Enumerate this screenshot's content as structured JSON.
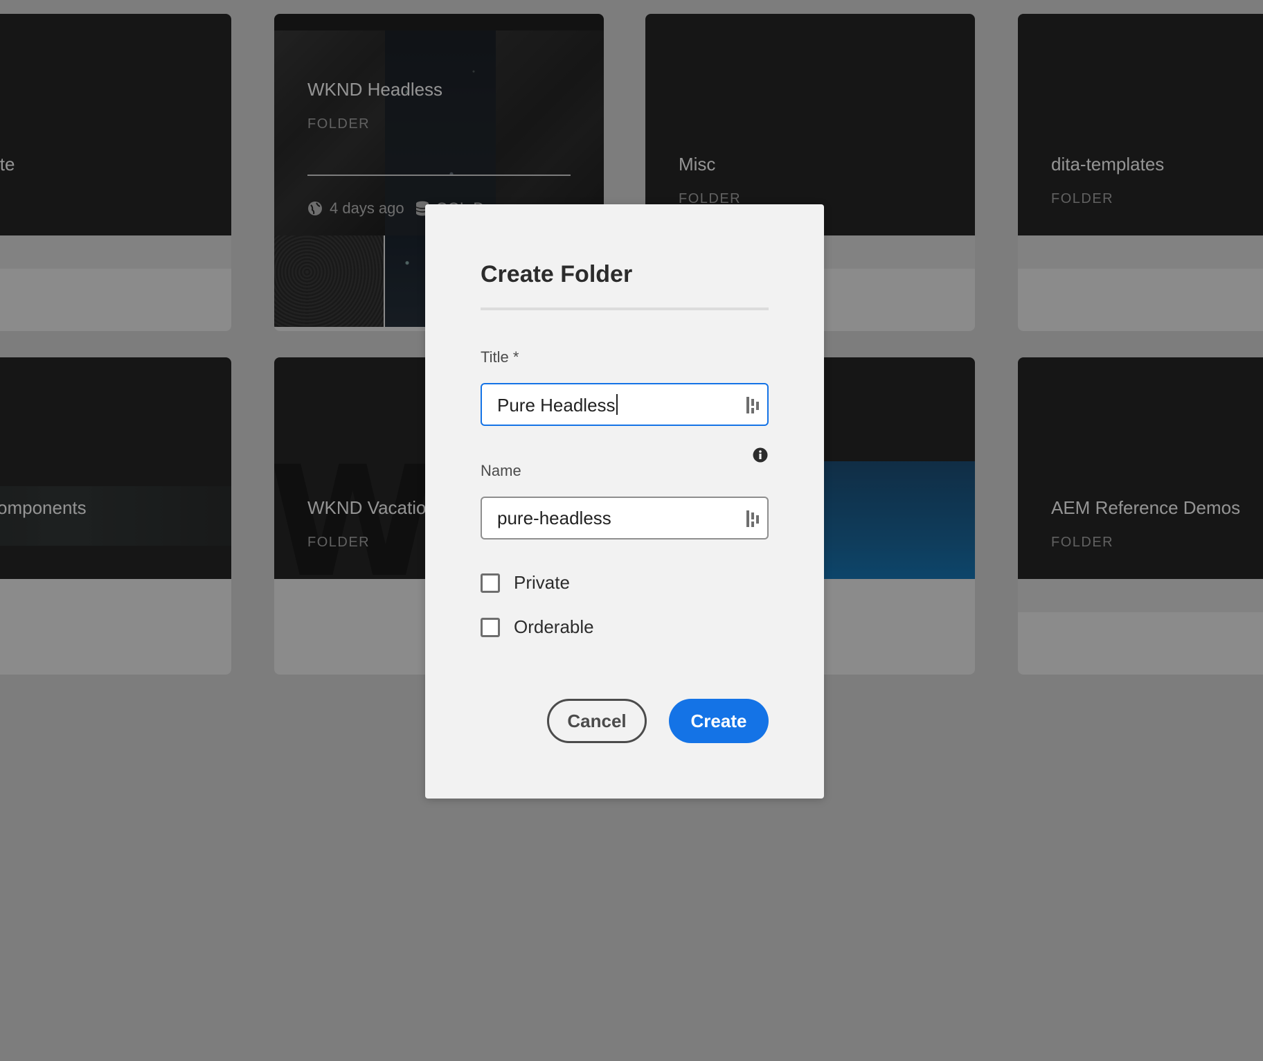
{
  "cards": [
    {
      "title": "ite",
      "type": ""
    },
    {
      "title": "WKND Headless",
      "type": "FOLDER",
      "modified": "4 days ago",
      "config": "GQL-Demo"
    },
    {
      "title": "Misc",
      "type": "FOLDER"
    },
    {
      "title": "dita-templates",
      "type": "FOLDER"
    },
    {
      "title": "omponents",
      "type": ""
    },
    {
      "title": "WKND Vacatio",
      "type": "FOLDER"
    },
    {
      "title": "",
      "type": ""
    },
    {
      "title": "AEM Reference Demos",
      "type": "FOLDER"
    }
  ],
  "dialog": {
    "title": "Create Folder",
    "title_label": "Title *",
    "title_value": "Pure Headless",
    "name_label": "Name",
    "name_value": "pure-headless",
    "private_label": "Private",
    "orderable_label": "Orderable",
    "cancel_label": "Cancel",
    "create_label": "Create",
    "private_checked": false,
    "orderable_checked": false
  },
  "icons": {
    "field_icon": "translate-icon",
    "info": "info-icon",
    "globe": "globe-icon",
    "database": "database-icon"
  },
  "colors": {
    "accent": "#1473e6",
    "overlay": "rgba(0,0,0,0.42)"
  }
}
